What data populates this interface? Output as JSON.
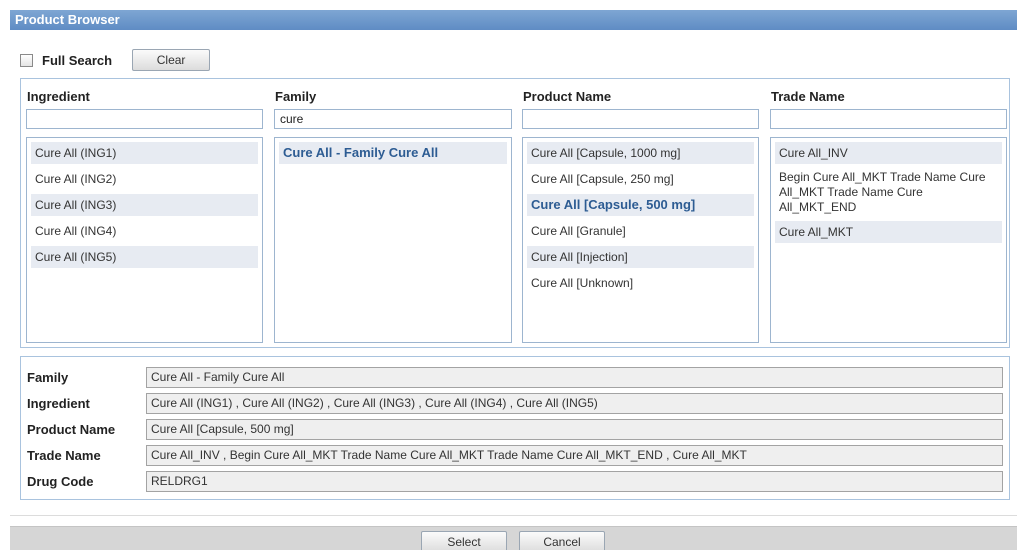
{
  "window": {
    "title": "Product Browser"
  },
  "search": {
    "full_search_label": "Full Search",
    "full_search_checked": false,
    "clear_label": "Clear"
  },
  "columns": [
    {
      "header": "Ingredient",
      "filter_value": "",
      "items": [
        {
          "label": "Cure All (ING1)",
          "selected": false
        },
        {
          "label": "Cure All (ING2)",
          "selected": false
        },
        {
          "label": "Cure All (ING3)",
          "selected": false
        },
        {
          "label": "Cure All (ING4)",
          "selected": false
        },
        {
          "label": "Cure All (ING5)",
          "selected": false
        }
      ]
    },
    {
      "header": "Family",
      "filter_value": "cure",
      "items": [
        {
          "label": "Cure All - Family Cure All",
          "selected": true
        }
      ]
    },
    {
      "header": "Product Name",
      "filter_value": "",
      "items": [
        {
          "label": "Cure All [Capsule, 1000 mg]",
          "selected": false
        },
        {
          "label": "Cure All [Capsule, 250 mg]",
          "selected": false
        },
        {
          "label": "Cure All [Capsule, 500 mg]",
          "selected": true
        },
        {
          "label": "Cure All [Granule]",
          "selected": false
        },
        {
          "label": "Cure All [Injection]",
          "selected": false
        },
        {
          "label": "Cure All [Unknown]",
          "selected": false
        }
      ]
    },
    {
      "header": "Trade Name",
      "filter_value": "",
      "items": [
        {
          "label": "Cure All_INV",
          "selected": false
        },
        {
          "label": "Begin Cure All_MKT Trade Name Cure All_MKT Trade Name Cure All_MKT_END",
          "selected": false
        },
        {
          "label": "Cure All_MKT",
          "selected": false
        }
      ]
    }
  ],
  "details": {
    "family": {
      "label": "Family",
      "value": "Cure All - Family Cure All"
    },
    "ingredient": {
      "label": "Ingredient",
      "value": "Cure All (ING1) , Cure All (ING2) , Cure All (ING3) , Cure All (ING4) , Cure All (ING5)"
    },
    "product_name": {
      "label": "Product Name",
      "value": "Cure All [Capsule, 500 mg]"
    },
    "trade_name": {
      "label": "Trade Name",
      "value": "Cure All_INV , Begin Cure All_MKT Trade Name Cure All_MKT Trade Name Cure All_MKT_END , Cure All_MKT"
    },
    "drug_code": {
      "label": "Drug Code",
      "value": "RELDRG1"
    }
  },
  "footer": {
    "select_label": "Select",
    "cancel_label": "Cancel"
  },
  "colors": {
    "title_bar": "#6b96cb",
    "border": "#a9c3de",
    "selected_text": "#2d5c93",
    "alt_row": "#e7ebf2"
  }
}
